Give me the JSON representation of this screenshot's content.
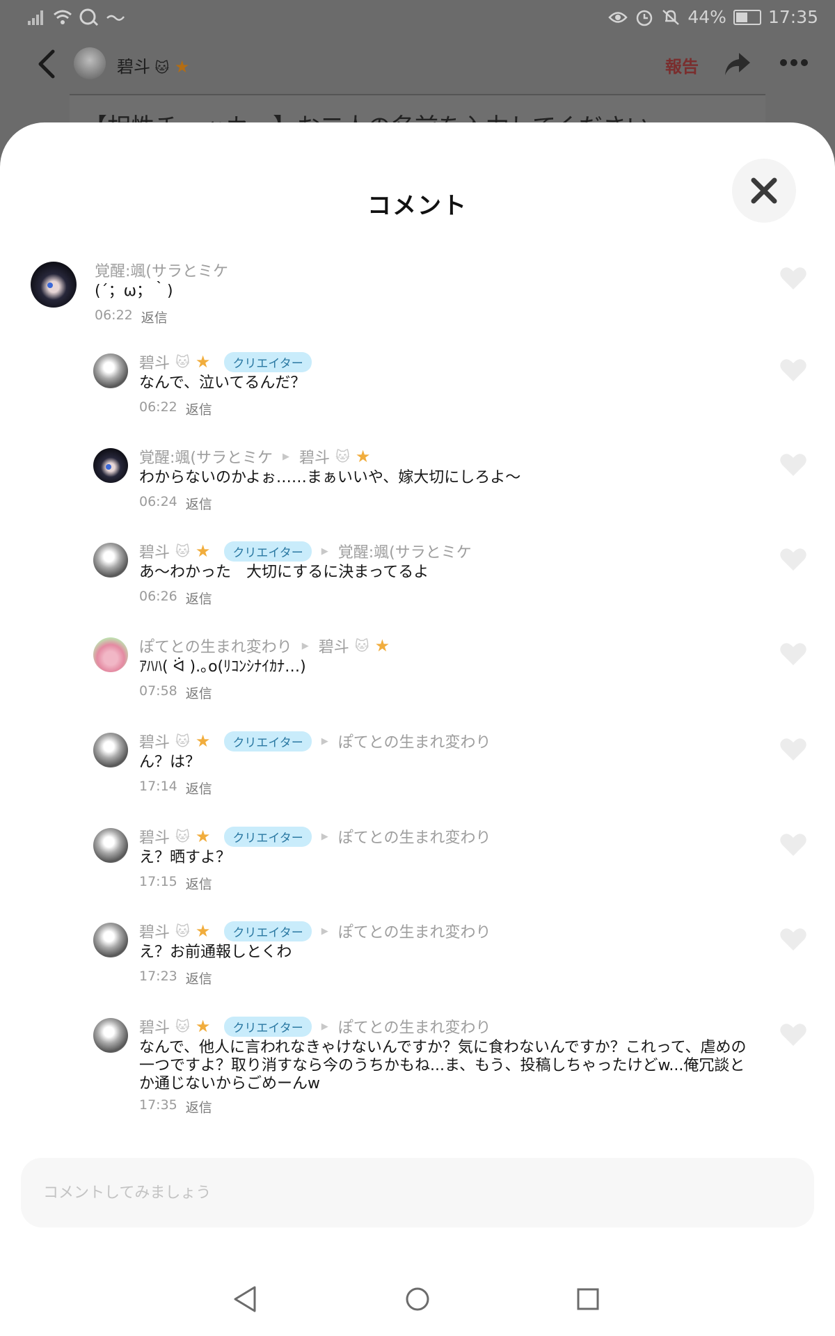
{
  "status_bar": {
    "battery": "44%",
    "time": "17:35"
  },
  "app_header": {
    "author": "碧斗",
    "report_label": "報告"
  },
  "background_post_title": "【相性チェッカー】お二人の名前を入力してください",
  "sheet": {
    "title": "コメント"
  },
  "comments": [
    {
      "name": "覚醒:颯(サラとミケ",
      "avatar": "kakusei",
      "text": "(´；ω；｀)",
      "time": "06:22",
      "reply": "返信",
      "top_level": true
    },
    {
      "name": "碧斗",
      "avatar": "bito",
      "creator": "クリエイター",
      "text": "なんで、泣いてるんだ？",
      "time": "06:22",
      "reply": "返信"
    },
    {
      "name": "覚醒:颯(サラとミケ",
      "avatar": "kakusei",
      "reply_to": "碧斗",
      "text": "わからないのかよぉ……まぁいいや、嫁大切にしろよ〜",
      "time": "06:24",
      "reply": "返信"
    },
    {
      "name": "碧斗",
      "avatar": "bito",
      "creator": "クリエイター",
      "reply_to": "覚醒:颯(サラとミケ",
      "text": "あ〜わかった　大切にするに決まってるよ",
      "time": "06:26",
      "reply": "返信"
    },
    {
      "name": "ぽてとの生まれ変わり",
      "avatar": "poteto",
      "reply_to": "碧斗",
      "text": "ｱﾊﾊ( ᐛ ).｡o(ﾘｺﾝｼﾅｲｶﾅ…)",
      "time": "07:58",
      "reply": "返信"
    },
    {
      "name": "碧斗",
      "avatar": "bito",
      "creator": "クリエイター",
      "reply_to": "ぽてとの生まれ変わり",
      "text": "ん？は？",
      "time": "17:14",
      "reply": "返信"
    },
    {
      "name": "碧斗",
      "avatar": "bito",
      "creator": "クリエイター",
      "reply_to": "ぽてとの生まれ変わり",
      "text": "え？晒すよ？",
      "time": "17:15",
      "reply": "返信"
    },
    {
      "name": "碧斗",
      "avatar": "bito",
      "creator": "クリエイター",
      "reply_to": "ぽてとの生まれ変わり",
      "text": "え？お前通報しとくわ",
      "time": "17:23",
      "reply": "返信"
    },
    {
      "name": "碧斗",
      "avatar": "bito",
      "creator": "クリエイター",
      "reply_to": "ぽてとの生まれ変わり",
      "text": "なんで、他人に言われなきゃけないんですか？気に食わないんですか？これって、虐めの一つですよ？取り消すなら今のうちかもね...ま、もう、投稿しちゃったけどw...俺冗談とか通じないからごめーんw",
      "time": "17:35",
      "reply": "返信"
    }
  ],
  "comment_input": {
    "placeholder": "コメントしてみましょう"
  },
  "icons": {
    "heart": "heart-icon",
    "close": "close-icon",
    "back": "chevron-left-icon",
    "share": "share-icon",
    "more": "more-icon",
    "arrow": "reply-arrow-icon"
  },
  "colors": {
    "badge_bg": "#c9ecfb",
    "badge_text": "#2a78a2",
    "star": "#f1ad3d",
    "report": "#7a2e2e"
  }
}
